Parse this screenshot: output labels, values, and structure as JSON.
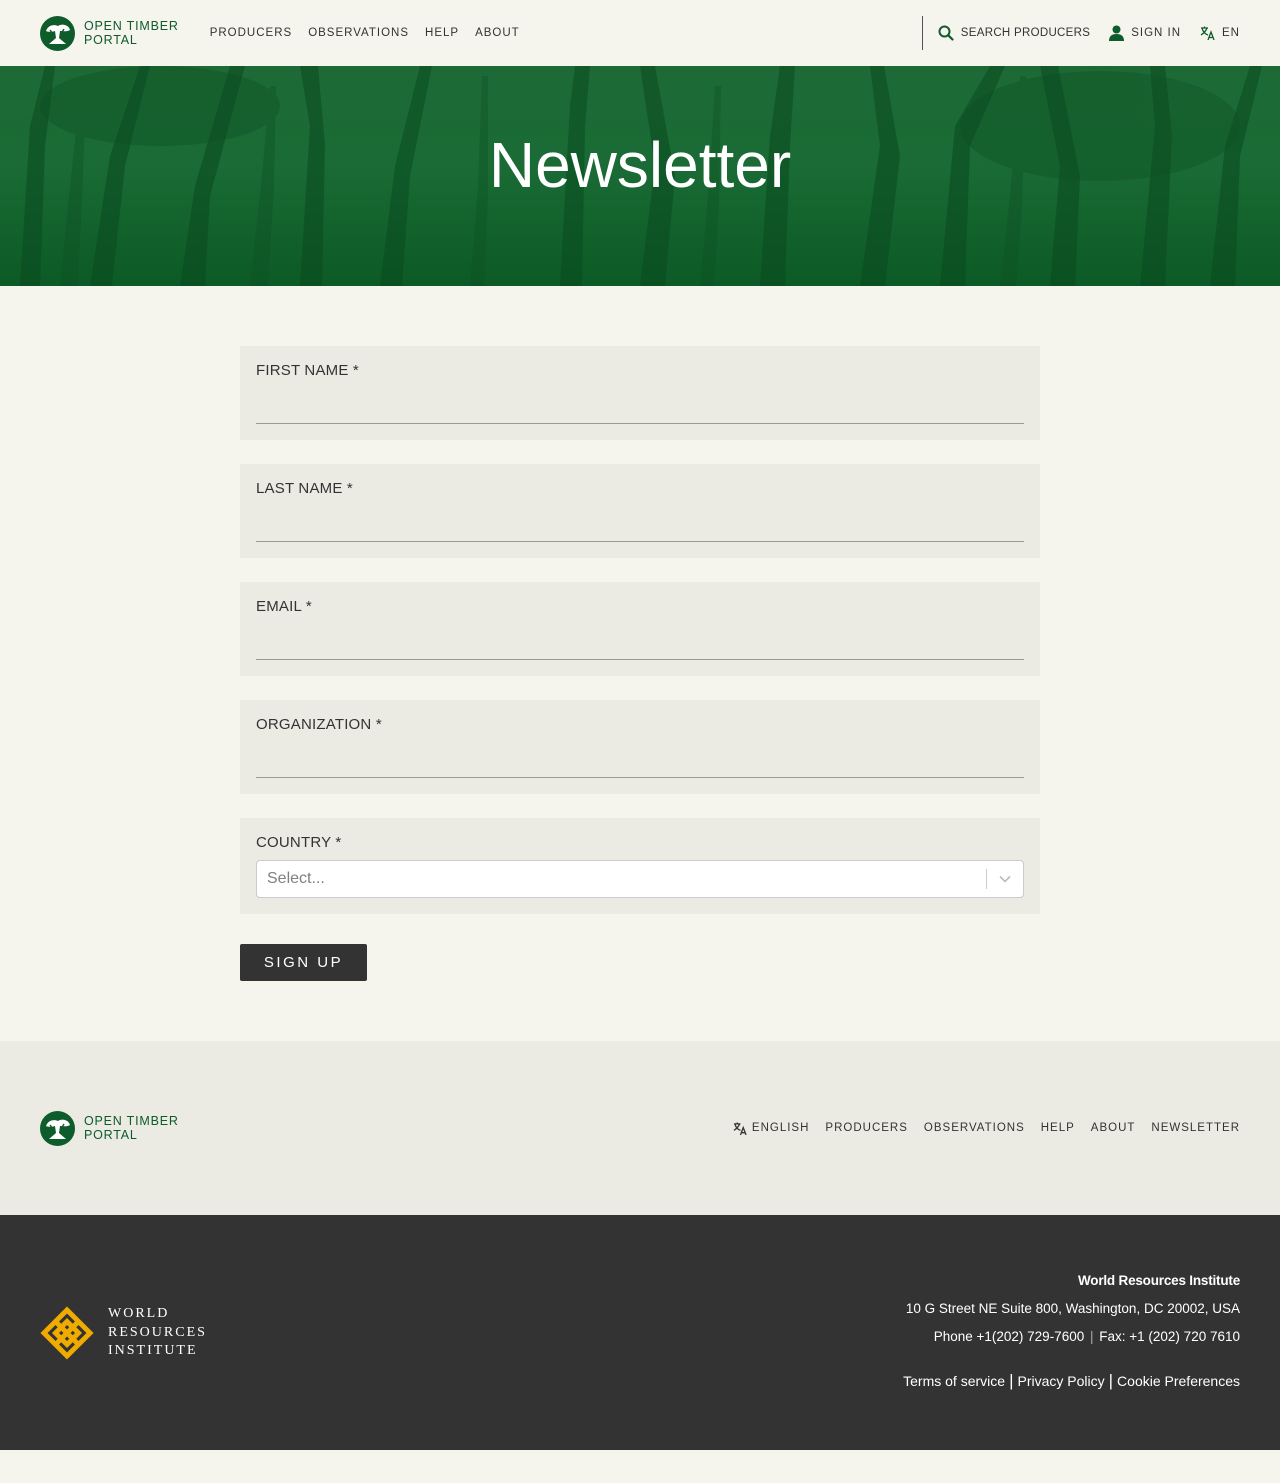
{
  "header": {
    "logo_line1": "OPEN TIMBER",
    "logo_line2": "PORTAL",
    "nav": [
      "PRODUCERS",
      "OBSERVATIONS",
      "HELP",
      "ABOUT"
    ],
    "search_label": "SEARCH PRODUCERS",
    "signin_label": "SIGN IN",
    "lang_label": "EN"
  },
  "hero": {
    "title": "Newsletter"
  },
  "form": {
    "first_name_label": "FIRST NAME *",
    "last_name_label": "LAST NAME *",
    "email_label": "EMAIL *",
    "organization_label": "ORGANIZATION *",
    "country_label": "COUNTRY *",
    "country_placeholder": "Select...",
    "submit_label": "SIGN UP"
  },
  "footer": {
    "logo_line1": "OPEN TIMBER",
    "logo_line2": "PORTAL",
    "nav": [
      "ENGLISH",
      "PRODUCERS",
      "OBSERVATIONS",
      "HELP",
      "ABOUT",
      "NEWSLETTER"
    ]
  },
  "wri": {
    "logo_line1": "WORLD",
    "logo_line2": "RESOURCES",
    "logo_line3": "INSTITUTE",
    "org_name": "World Resources Institute",
    "address": "10 G Street NE Suite 800, Washington, DC 20002, USA",
    "phone": "Phone +1(202) 729-7600",
    "fax": "Fax: +1 (202) 720 7610",
    "terms": "Terms of service",
    "privacy": "Privacy Policy",
    "cookies": "Cookie Preferences"
  },
  "colors": {
    "brand_green": "#0e5b2b",
    "background": "#f5f4ed",
    "field_bg": "#ebeae3",
    "dark": "#333333",
    "wri_gold": "#f0ab00"
  },
  "icons": [
    "tree-logo-icon",
    "search-icon",
    "user-icon",
    "translate-icon",
    "chevron-down-icon",
    "wri-logo-icon"
  ]
}
